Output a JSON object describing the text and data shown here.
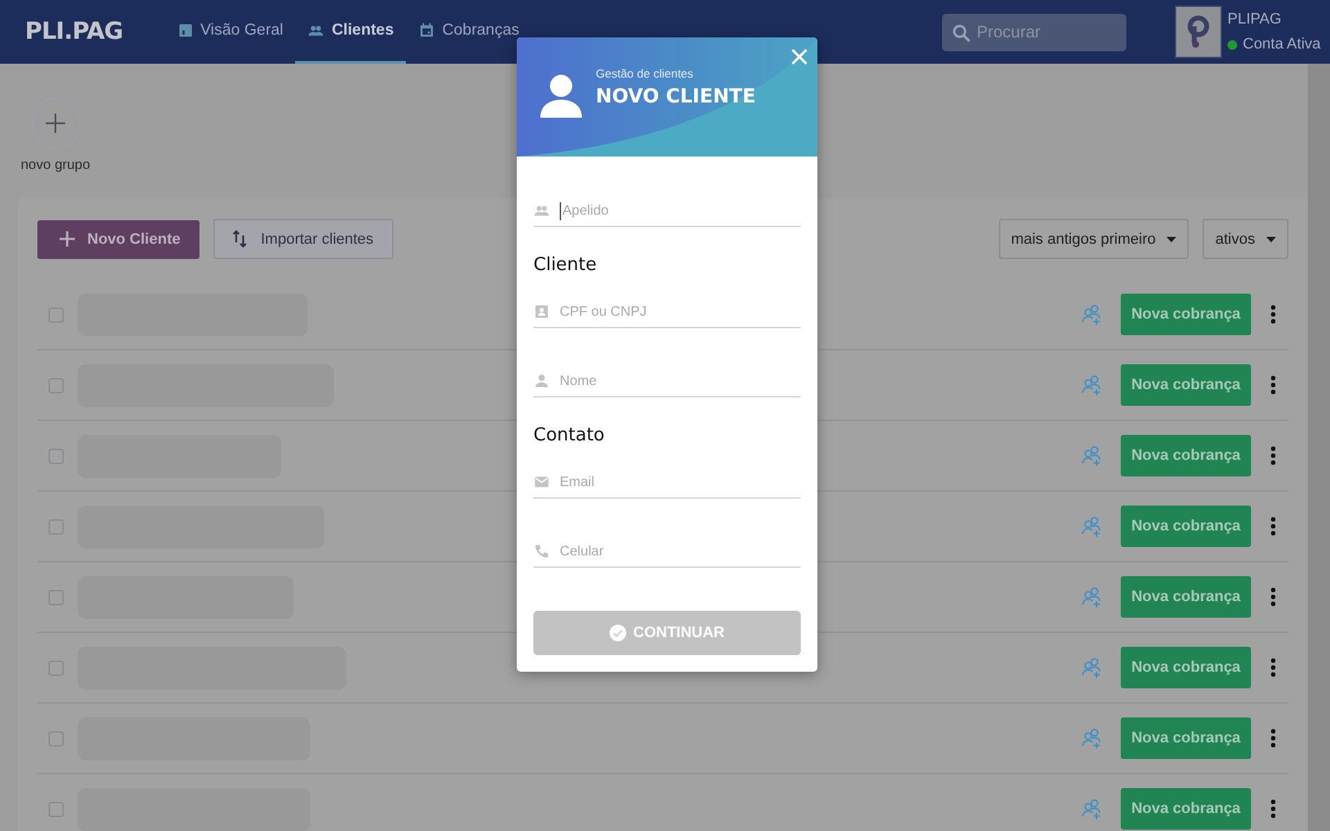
{
  "header": {
    "logo": "PLI.PAG",
    "tabs": [
      {
        "label": "Visão Geral",
        "selected": false
      },
      {
        "label": "Clientes",
        "selected": true
      },
      {
        "label": "Cobranças",
        "selected": false
      }
    ],
    "search": {
      "placeholder": "Procurar"
    },
    "account": {
      "name": "PLIPAG",
      "status": "Conta Ativa",
      "active": true
    }
  },
  "groups": {
    "add_label": "novo grupo"
  },
  "toolbar": {
    "new_button": "Novo Cliente",
    "import_button": "Importar clientes",
    "sort": "mais antigos primeiro",
    "filter": "ativos"
  },
  "rows": [
    {
      "checked": false,
      "action": "Nova cobrança"
    },
    {
      "checked": false,
      "action": "Nova cobrança"
    },
    {
      "checked": false,
      "action": "Nova cobrança"
    },
    {
      "checked": false,
      "action": "Nova cobrança"
    },
    {
      "checked": false,
      "action": "Nova cobrança"
    },
    {
      "checked": false,
      "action": "Nova cobrança"
    },
    {
      "checked": false,
      "action": "Nova cobrança"
    },
    {
      "checked": false,
      "action": "Nova cobrança"
    }
  ],
  "dialog": {
    "subtitle": "Gestão de clientes",
    "title": "NOVO CLIENTE",
    "sections": [
      {
        "fields": [
          {
            "placeholder": "Apelido",
            "focused": true
          }
        ]
      },
      {
        "heading": "Cliente",
        "fields": [
          {
            "placeholder": "CPF ou CNPJ",
            "focused": false
          },
          {
            "placeholder": "Nome",
            "focused": false
          }
        ]
      },
      {
        "heading": "Contato",
        "fields": [
          {
            "placeholder": "Email",
            "focused": false
          },
          {
            "placeholder": "Celular",
            "focused": false
          }
        ]
      }
    ],
    "submit": {
      "label": "CONTINUAR",
      "disabled": true
    }
  }
}
